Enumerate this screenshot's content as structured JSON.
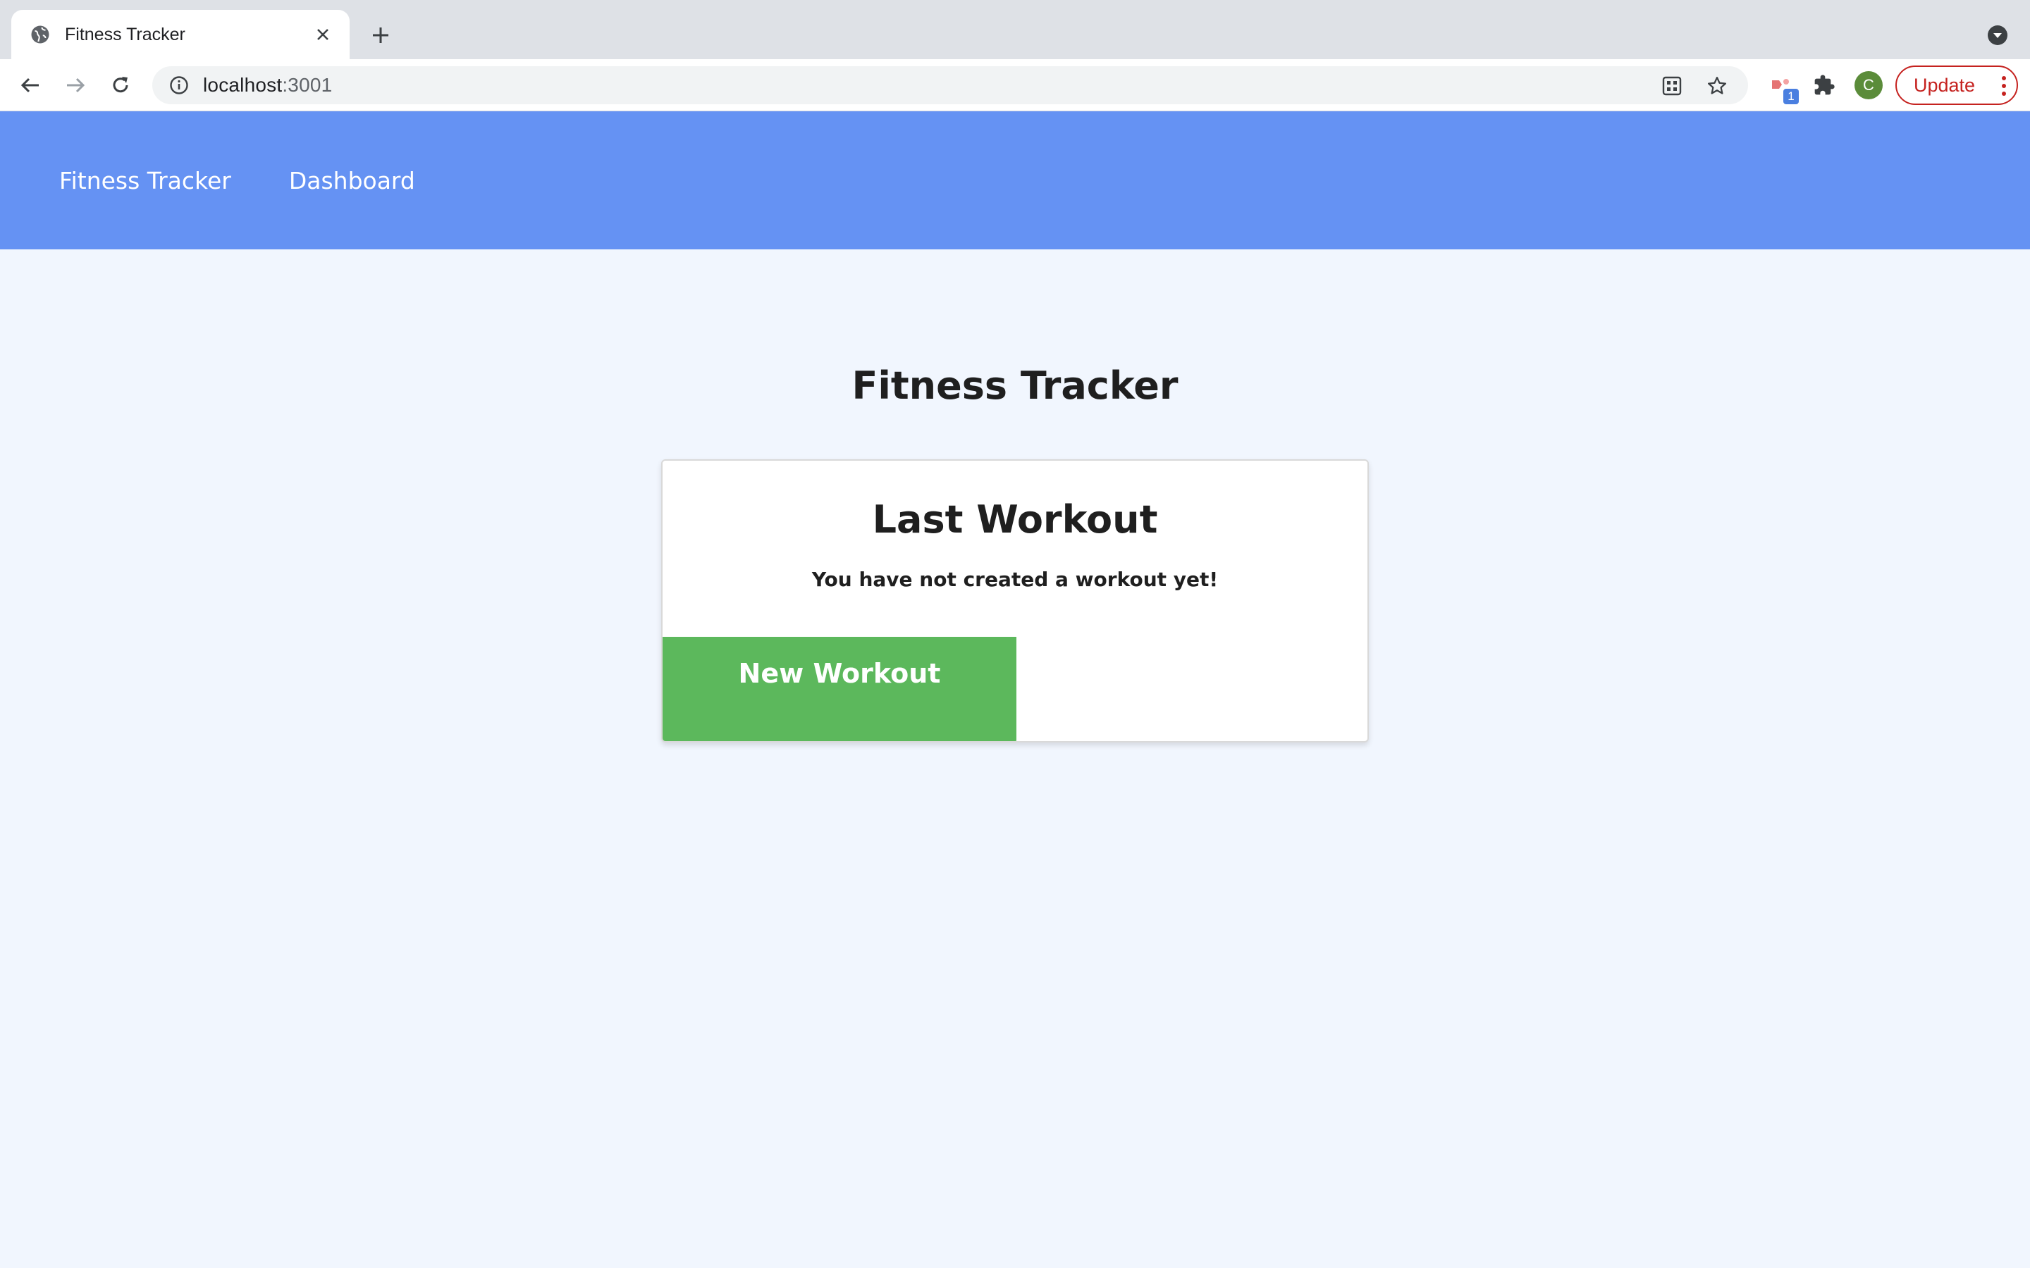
{
  "browser": {
    "tab": {
      "title": "Fitness Tracker"
    },
    "address": {
      "host": "localhost",
      "port": ":3001"
    },
    "extension_badge": "1",
    "profile_initial": "C",
    "update_label": "Update",
    "colors": {
      "update": "#c5221f",
      "avatar": "#5b8c3a"
    }
  },
  "navbar": {
    "brand": "Fitness Tracker",
    "links": [
      "Dashboard"
    ],
    "color": "#6592f3"
  },
  "main": {
    "title": "Fitness Tracker",
    "card": {
      "title": "Last Workout",
      "message": "You have not created a workout yet!",
      "button_label": "New Workout",
      "button_color": "#5cb85c"
    }
  }
}
